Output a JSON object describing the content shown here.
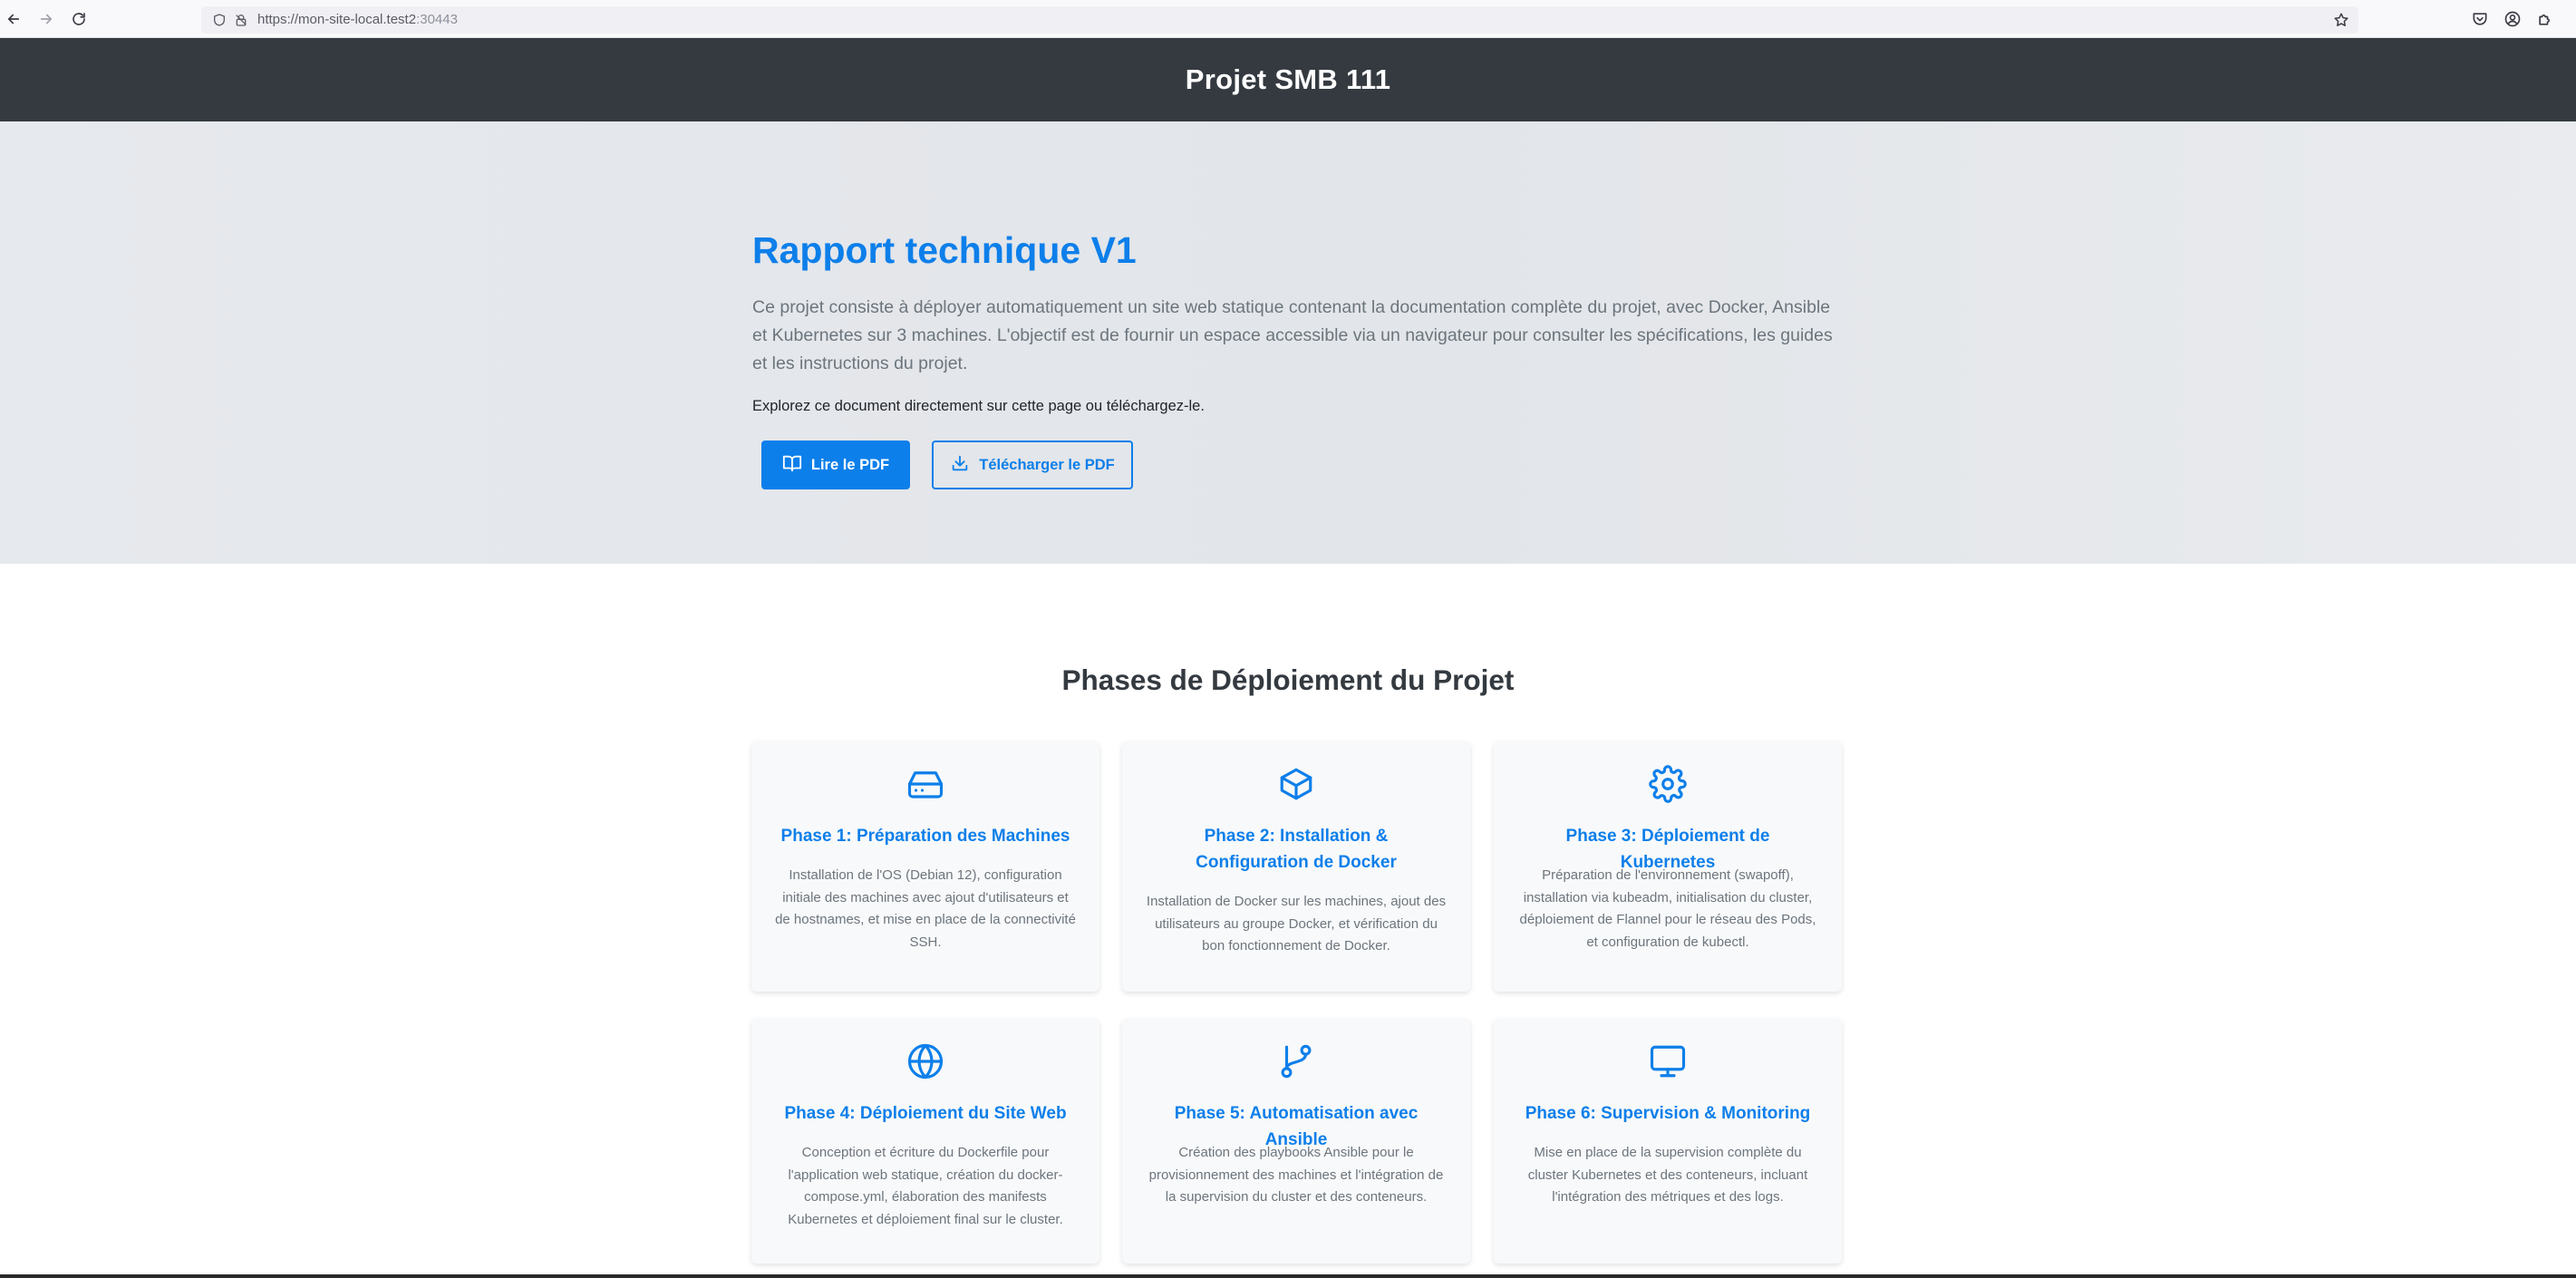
{
  "browser": {
    "url_host": "https://mon-site-local.test2",
    "url_port": ":30443"
  },
  "header": {
    "title": "Projet SMB 111"
  },
  "hero": {
    "title": "Rapport technique V1",
    "description": "Ce projet consiste à déployer automatiquement un site web statique contenant la documentation complète du projet, avec Docker, Ansible et Kubernetes sur 3 machines. L'objectif est de fournir un espace accessible via un navigateur pour consulter les spécifications, les guides et les instructions du projet.",
    "explore_text": "Explorez ce document directement sur cette page ou téléchargez-le.",
    "read_button": "Lire le PDF",
    "download_button": "Télécharger le PDF"
  },
  "phases": {
    "title": "Phases de Déploiement du Projet",
    "cards": [
      {
        "icon": "hard-drive-icon",
        "title": "Phase 1: Préparation des Machines",
        "description": "Installation de l'OS (Debian 12), configuration initiale des machines avec ajout d'utilisateurs et de hostnames, et mise en place de la connectivité SSH."
      },
      {
        "icon": "box-icon",
        "title": "Phase 2: Installation & Configuration de Docker",
        "description": "Installation de Docker sur les machines, ajout des utilisateurs au groupe Docker, et vérification du bon fonctionnement de Docker."
      },
      {
        "icon": "gear-icon",
        "title": "Phase 3: Déploiement de Kubernetes",
        "description": "Préparation de l'environnement (swapoff), installation via kubeadm, initialisation du cluster, déploiement de Flannel pour le réseau des Pods, et configuration de kubectl."
      },
      {
        "icon": "globe-icon",
        "title": "Phase 4: Déploiement du Site Web",
        "description": "Conception et écriture du Dockerfile pour l'application web statique, création du docker-compose.yml, élaboration des manifests Kubernetes et déploiement final sur le cluster."
      },
      {
        "icon": "git-branch-icon",
        "title": "Phase 5: Automatisation avec Ansible",
        "description": "Création des playbooks Ansible pour le provisionnement des machines et l'intégration de la supervision du cluster et des conteneurs."
      },
      {
        "icon": "monitor-icon",
        "title": "Phase 6: Supervision & Monitoring",
        "description": "Mise en place de la supervision complète du cluster Kubernetes et des conteneurs, incluant l'intégration des métriques et des logs."
      }
    ]
  },
  "colors": {
    "accent": "#0d7fea",
    "header_bg": "#343a40",
    "hero_bg": "#e4e7eb",
    "card_bg": "#f8f9fa",
    "muted_text": "#6c757d"
  }
}
